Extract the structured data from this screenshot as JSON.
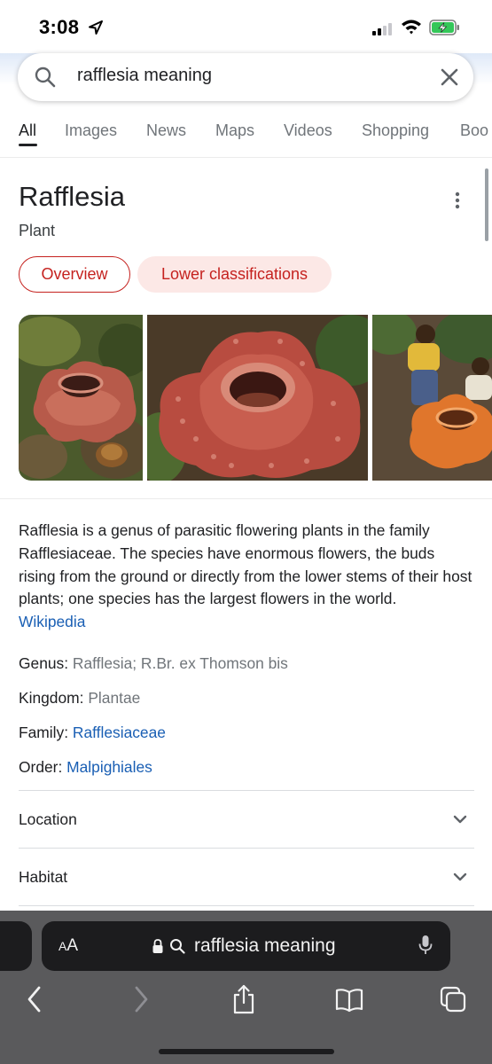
{
  "status_bar": {
    "time": "3:08"
  },
  "search": {
    "query": "rafflesia meaning"
  },
  "tabs": [
    {
      "label": "All",
      "active": true
    },
    {
      "label": "Images"
    },
    {
      "label": "News"
    },
    {
      "label": "Maps"
    },
    {
      "label": "Videos"
    },
    {
      "label": "Shopping"
    },
    {
      "label": "Boo"
    }
  ],
  "knowledge_panel": {
    "title": "Rafflesia",
    "subtitle": "Plant",
    "chips": [
      "Overview",
      "Lower classifications"
    ],
    "description": "Rafflesia is a genus of parasitic flowering plants in the family Rafflesiaceae. The species have enormous flowers, the buds rising from the ground or directly from the lower stems of their host plants; one species has the largest flowers in the world.",
    "source_link": "Wikipedia",
    "facts": [
      {
        "label": "Genus:",
        "value": "Rafflesia; R.Br. ex Thomson bis",
        "is_link": false
      },
      {
        "label": "Kingdom:",
        "value": "Plantae",
        "is_link": false
      },
      {
        "label": "Family:",
        "value": "Rafflesiaceae",
        "is_link": true
      },
      {
        "label": "Order:",
        "value": "Malpighiales",
        "is_link": true
      }
    ],
    "sections": [
      "Location",
      "Habitat"
    ]
  },
  "browser": {
    "text_size_label": "AA",
    "url_text": "rafflesia meaning"
  },
  "colors": {
    "accent_red": "#c5221f",
    "chip_fill": "#fce8e6",
    "link_blue": "#1a5fb4",
    "safari_bg": "#5a5a5c"
  }
}
